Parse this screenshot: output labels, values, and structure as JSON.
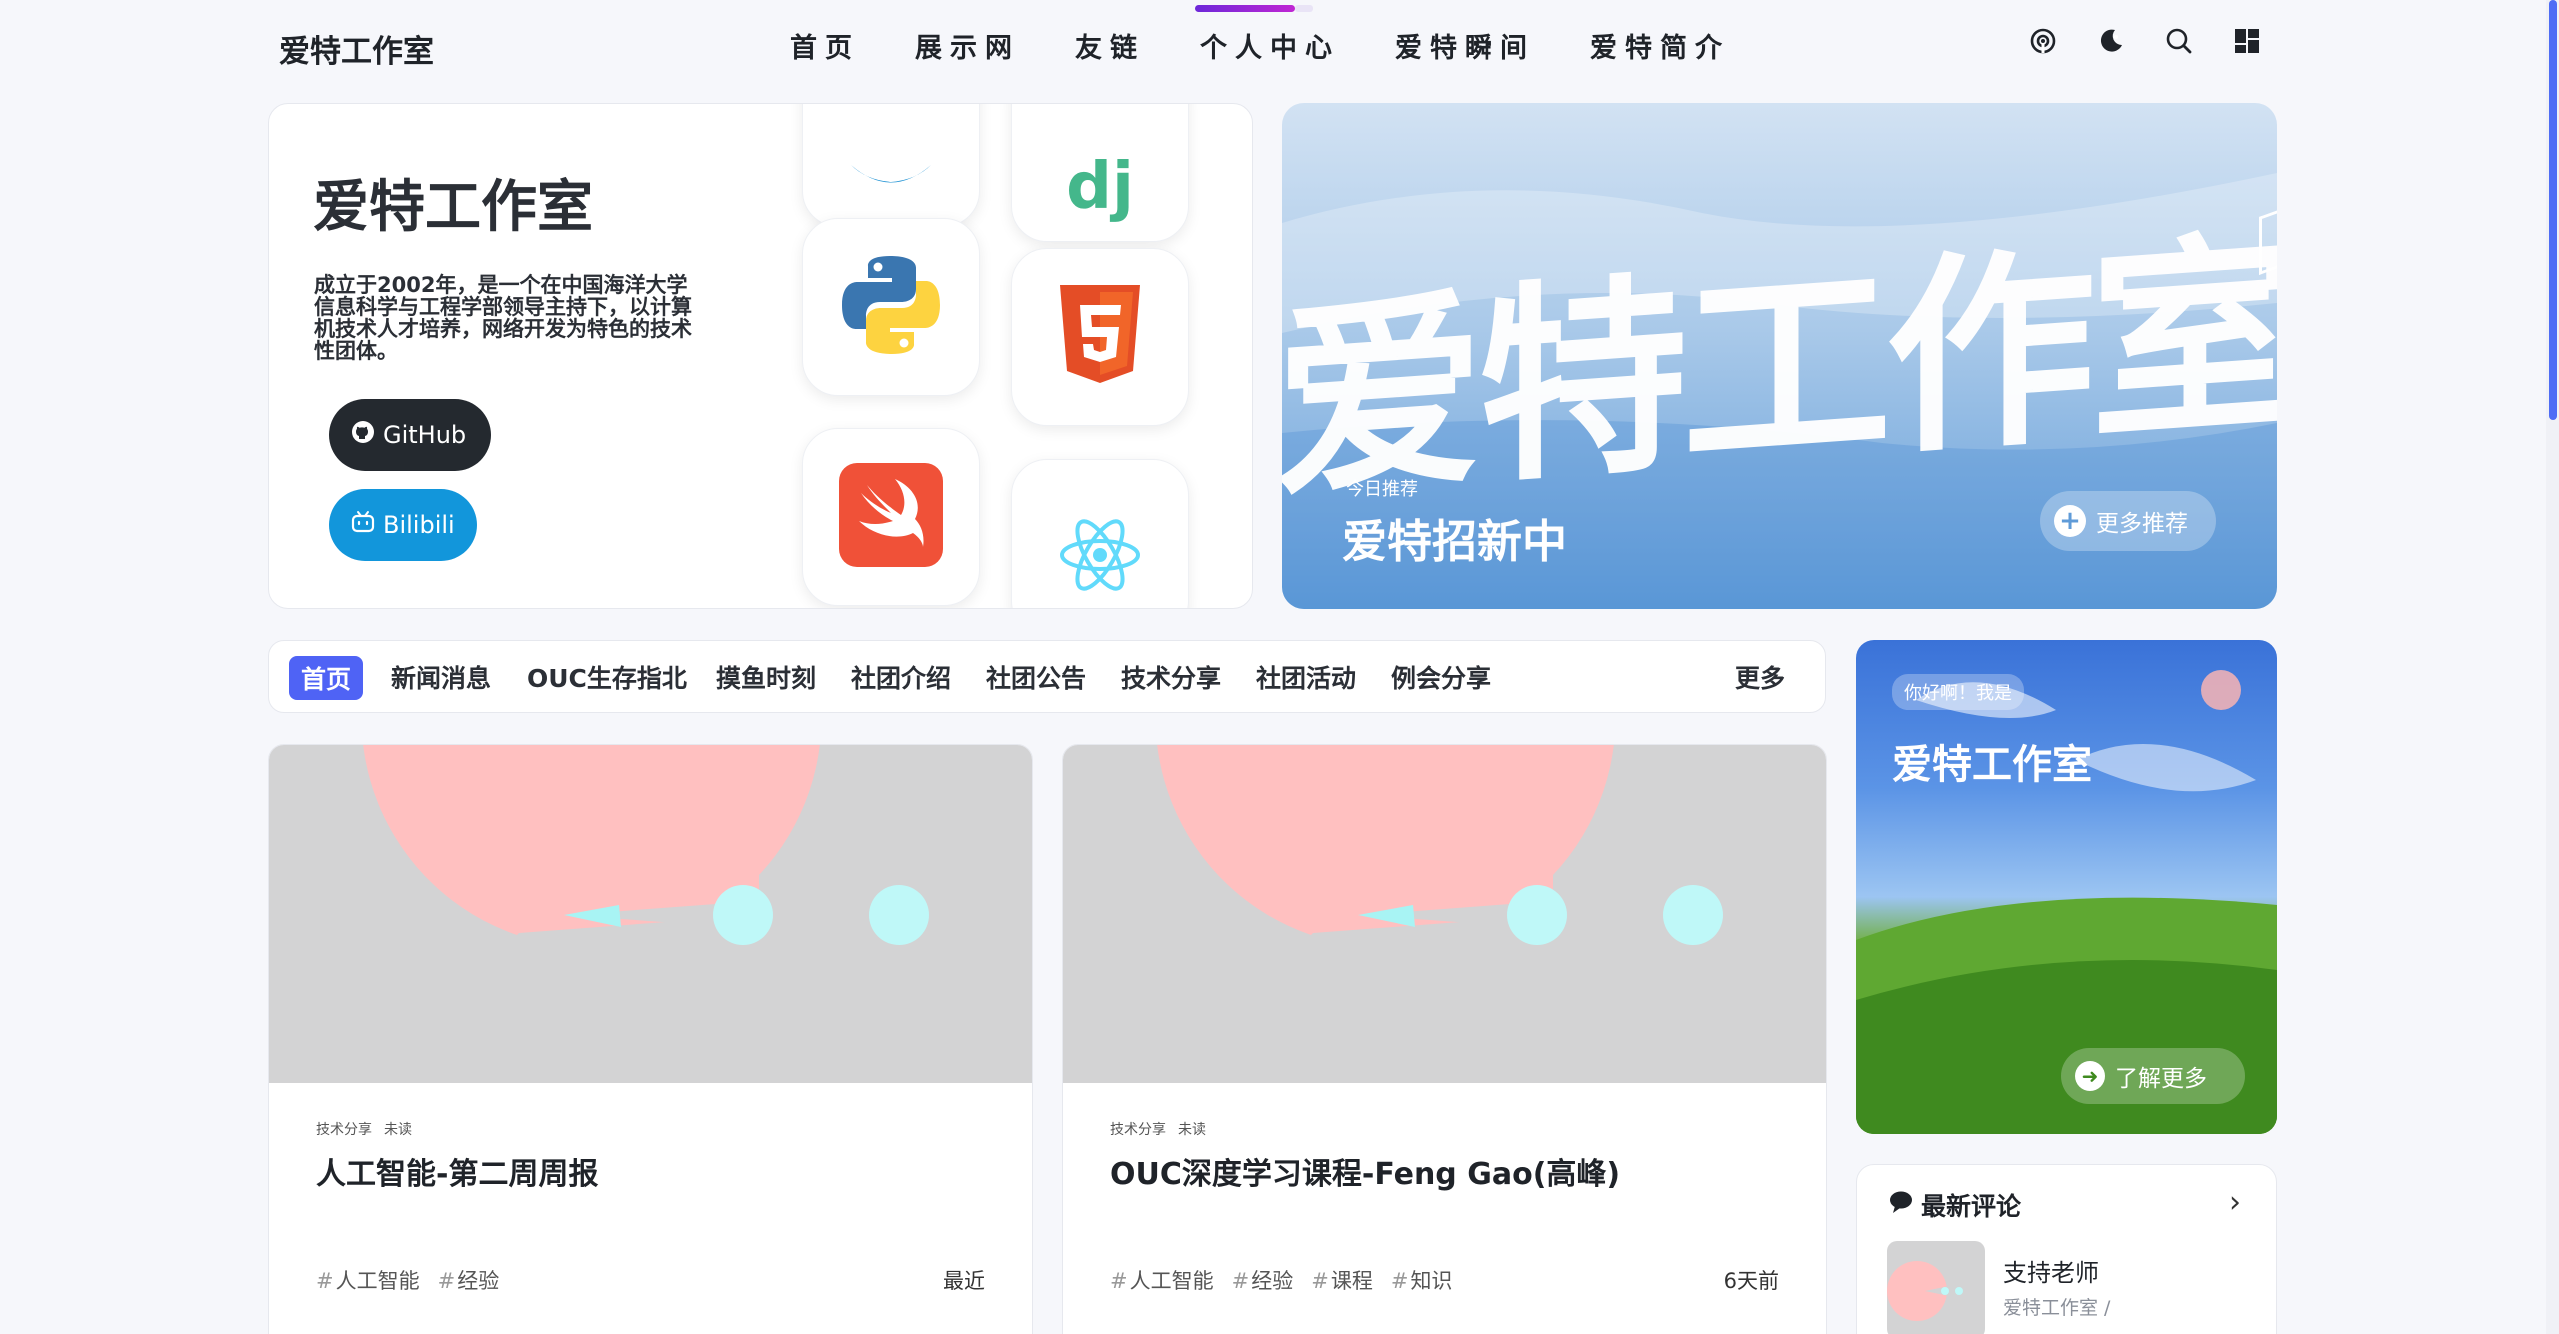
{
  "header": {
    "brand": "爱特工作室",
    "nav": [
      "首页",
      "展示网",
      "友链",
      "个人中心",
      "爱特瞬间",
      "爱特简介"
    ],
    "active_nav": "个人中心",
    "icons": [
      "rss-icon",
      "moon-icon",
      "search-icon",
      "grid-icon"
    ]
  },
  "hero": {
    "title": "爱特工作室",
    "description": "成立于2002年，是一个在中国海洋大学信息科学与工程学部领导主持下，以计算机技术人才培养，网络开发为特色的技术性团体。",
    "github_label": "GitHub",
    "bilibili_label": "Bilibili",
    "tiles": [
      "docker-icon",
      "django-icon",
      "python-icon",
      "html5-icon",
      "swift-icon",
      "react-icon"
    ]
  },
  "banner": {
    "big_text": "爱特工作室",
    "subtitle": "今日推荐",
    "title": "爱特招新中",
    "more_label": "更多推荐"
  },
  "categories": {
    "items": [
      "首页",
      "新闻消息",
      "OUC生存指北",
      "摸鱼时刻",
      "社团介绍",
      "社团公告",
      "技术分享",
      "社团活动",
      "例会分享"
    ],
    "more_label": "更多"
  },
  "posts": [
    {
      "category": "技术分享",
      "status": "未读",
      "title": "人工智能-第二周周报",
      "tags": [
        "人工智能",
        "经验"
      ],
      "time": "最近"
    },
    {
      "category": "技术分享",
      "status": "未读",
      "title": "OUC深度学习课程-Feng Gao(高峰)",
      "tags": [
        "人工智能",
        "经验",
        "课程",
        "知识"
      ],
      "time": "6天前"
    }
  ],
  "side_card": {
    "hello": "你好啊！我是",
    "title": "爱特工作室",
    "more_label": "了解更多"
  },
  "comments": {
    "title": "最新评论",
    "item": {
      "name": "支持老师",
      "from": "爱特工作室 /"
    }
  },
  "colors": {
    "accent": "#4f63f5",
    "nav_indicator": "#7c3aed",
    "github_btn": "#24292f",
    "bilibili_btn": "#1296db"
  }
}
